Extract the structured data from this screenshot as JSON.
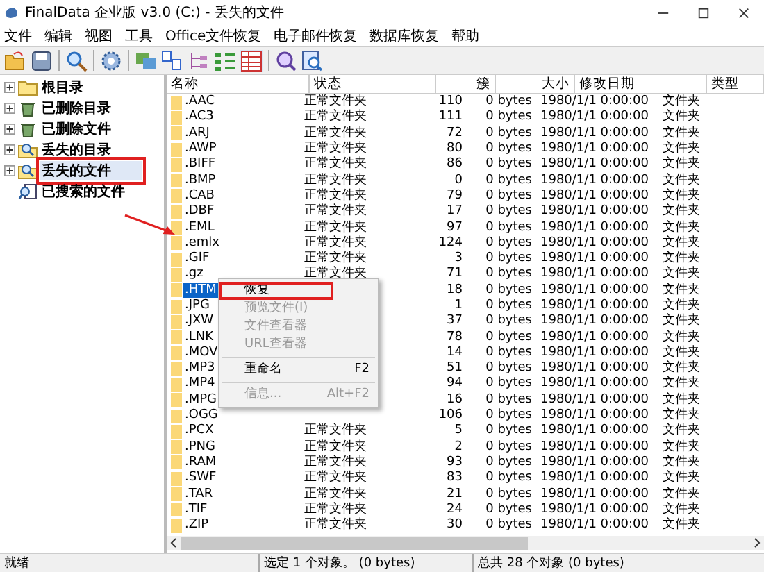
{
  "window": {
    "title": "FinalData 企业版 v3.0 (C:) - 丢失的文件"
  },
  "menu": [
    "文件",
    "编辑",
    "视图",
    "工具",
    "Office文件恢复",
    "电子邮件恢复",
    "数据库恢复",
    "帮助"
  ],
  "tree": [
    {
      "label": "根目录",
      "kind": "folder",
      "expandable": true,
      "selected": false,
      "annotated": false
    },
    {
      "label": "已删除目录",
      "kind": "recycle",
      "expandable": true,
      "selected": false,
      "annotated": false
    },
    {
      "label": "已删除文件",
      "kind": "recycle",
      "expandable": true,
      "selected": false,
      "annotated": false
    },
    {
      "label": "丢失的目录",
      "kind": "search",
      "expandable": true,
      "selected": false,
      "annotated": false
    },
    {
      "label": "丢失的文件",
      "kind": "search",
      "expandable": true,
      "selected": true,
      "annotated": true
    },
    {
      "label": "已搜索的文件",
      "kind": "found",
      "expandable": false,
      "selected": false,
      "annotated": false
    }
  ],
  "table": {
    "columns": [
      "名称",
      "状态",
      "簇",
      "大小",
      "修改日期",
      "类型"
    ],
    "rows": [
      {
        "name": ".AAC",
        "status": "正常文件夹",
        "clusters": "110",
        "size": "0 bytes",
        "modified": "1980/1/1 0:00:00",
        "type": "文件夹",
        "selected": false
      },
      {
        "name": ".AC3",
        "status": "正常文件夹",
        "clusters": "111",
        "size": "0 bytes",
        "modified": "1980/1/1 0:00:00",
        "type": "文件夹",
        "selected": false
      },
      {
        "name": ".ARJ",
        "status": "正常文件夹",
        "clusters": "72",
        "size": "0 bytes",
        "modified": "1980/1/1 0:00:00",
        "type": "文件夹",
        "selected": false
      },
      {
        "name": ".AWP",
        "status": "正常文件夹",
        "clusters": "80",
        "size": "0 bytes",
        "modified": "1980/1/1 0:00:00",
        "type": "文件夹",
        "selected": false
      },
      {
        "name": ".BIFF",
        "status": "正常文件夹",
        "clusters": "86",
        "size": "0 bytes",
        "modified": "1980/1/1 0:00:00",
        "type": "文件夹",
        "selected": false
      },
      {
        "name": ".BMP",
        "status": "正常文件夹",
        "clusters": "0",
        "size": "0 bytes",
        "modified": "1980/1/1 0:00:00",
        "type": "文件夹",
        "selected": false
      },
      {
        "name": ".CAB",
        "status": "正常文件夹",
        "clusters": "79",
        "size": "0 bytes",
        "modified": "1980/1/1 0:00:00",
        "type": "文件夹",
        "selected": false
      },
      {
        "name": ".DBF",
        "status": "正常文件夹",
        "clusters": "17",
        "size": "0 bytes",
        "modified": "1980/1/1 0:00:00",
        "type": "文件夹",
        "selected": false
      },
      {
        "name": ".EML",
        "status": "正常文件夹",
        "clusters": "97",
        "size": "0 bytes",
        "modified": "1980/1/1 0:00:00",
        "type": "文件夹",
        "selected": false
      },
      {
        "name": ".emlx",
        "status": "正常文件夹",
        "clusters": "124",
        "size": "0 bytes",
        "modified": "1980/1/1 0:00:00",
        "type": "文件夹",
        "selected": false
      },
      {
        "name": ".GIF",
        "status": "正常文件夹",
        "clusters": "3",
        "size": "0 bytes",
        "modified": "1980/1/1 0:00:00",
        "type": "文件夹",
        "selected": false
      },
      {
        "name": ".gz",
        "status": "正常文件夹",
        "clusters": "71",
        "size": "0 bytes",
        "modified": "1980/1/1 0:00:00",
        "type": "文件夹",
        "selected": false
      },
      {
        "name": ".HTM",
        "clusters": "18",
        "size": "0 bytes",
        "modified": "1980/1/1 0:00:00",
        "type": "文件夹",
        "selected": true
      },
      {
        "name": ".JPG",
        "clusters": "1",
        "size": "0 bytes",
        "modified": "1980/1/1 0:00:00",
        "type": "文件夹",
        "selected": false
      },
      {
        "name": ".JXW",
        "clusters": "37",
        "size": "0 bytes",
        "modified": "1980/1/1 0:00:00",
        "type": "文件夹",
        "selected": false
      },
      {
        "name": ".LNK",
        "clusters": "78",
        "size": "0 bytes",
        "modified": "1980/1/1 0:00:00",
        "type": "文件夹",
        "selected": false
      },
      {
        "name": ".MOV",
        "clusters": "14",
        "size": "0 bytes",
        "modified": "1980/1/1 0:00:00",
        "type": "文件夹",
        "selected": false
      },
      {
        "name": ".MP3",
        "clusters": "51",
        "size": "0 bytes",
        "modified": "1980/1/1 0:00:00",
        "type": "文件夹",
        "selected": false
      },
      {
        "name": ".MP4",
        "clusters": "94",
        "size": "0 bytes",
        "modified": "1980/1/1 0:00:00",
        "type": "文件夹",
        "selected": false
      },
      {
        "name": ".MPG",
        "clusters": "16",
        "size": "0 bytes",
        "modified": "1980/1/1 0:00:00",
        "type": "文件夹",
        "selected": false
      },
      {
        "name": ".OGG",
        "clusters": "106",
        "size": "0 bytes",
        "modified": "1980/1/1 0:00:00",
        "type": "文件夹",
        "selected": false
      },
      {
        "name": ".PCX",
        "status": "正常文件夹",
        "clusters": "5",
        "size": "0 bytes",
        "modified": "1980/1/1 0:00:00",
        "type": "文件夹",
        "selected": false
      },
      {
        "name": ".PNG",
        "status": "正常文件夹",
        "clusters": "2",
        "size": "0 bytes",
        "modified": "1980/1/1 0:00:00",
        "type": "文件夹",
        "selected": false
      },
      {
        "name": ".RAM",
        "status": "正常文件夹",
        "clusters": "93",
        "size": "0 bytes",
        "modified": "1980/1/1 0:00:00",
        "type": "文件夹",
        "selected": false
      },
      {
        "name": ".SWF",
        "status": "正常文件夹",
        "clusters": "83",
        "size": "0 bytes",
        "modified": "1980/1/1 0:00:00",
        "type": "文件夹",
        "selected": false
      },
      {
        "name": ".TAR",
        "status": "正常文件夹",
        "clusters": "21",
        "size": "0 bytes",
        "modified": "1980/1/1 0:00:00",
        "type": "文件夹",
        "selected": false
      },
      {
        "name": ".TIF",
        "status": "正常文件夹",
        "clusters": "24",
        "size": "0 bytes",
        "modified": "1980/1/1 0:00:00",
        "type": "文件夹",
        "selected": false
      },
      {
        "name": ".ZIP",
        "status": "正常文件夹",
        "clusters": "30",
        "size": "0 bytes",
        "modified": "1980/1/1 0:00:00",
        "type": "文件夹",
        "selected": false
      }
    ]
  },
  "context_menu": [
    {
      "kind": "item",
      "label": "恢复",
      "disabled": false,
      "annotated": true
    },
    {
      "kind": "item",
      "label": "预览文件(I)",
      "disabled": true,
      "annotated": false
    },
    {
      "kind": "item",
      "label": "文件查看器",
      "disabled": true,
      "annotated": false
    },
    {
      "kind": "item",
      "label": "URL查看器",
      "disabled": true,
      "annotated": false
    },
    {
      "kind": "separator"
    },
    {
      "kind": "item",
      "label": "重命名",
      "shortcut": "F2",
      "disabled": false,
      "annotated": false
    },
    {
      "kind": "separator"
    },
    {
      "kind": "item",
      "label": "信息...",
      "shortcut": "Alt+F2",
      "disabled": true,
      "annotated": false
    }
  ],
  "status_bar": [
    "就绪",
    "选定 1 个对象。 (0 bytes)",
    "总共 28 个对象 (0 bytes)"
  ]
}
